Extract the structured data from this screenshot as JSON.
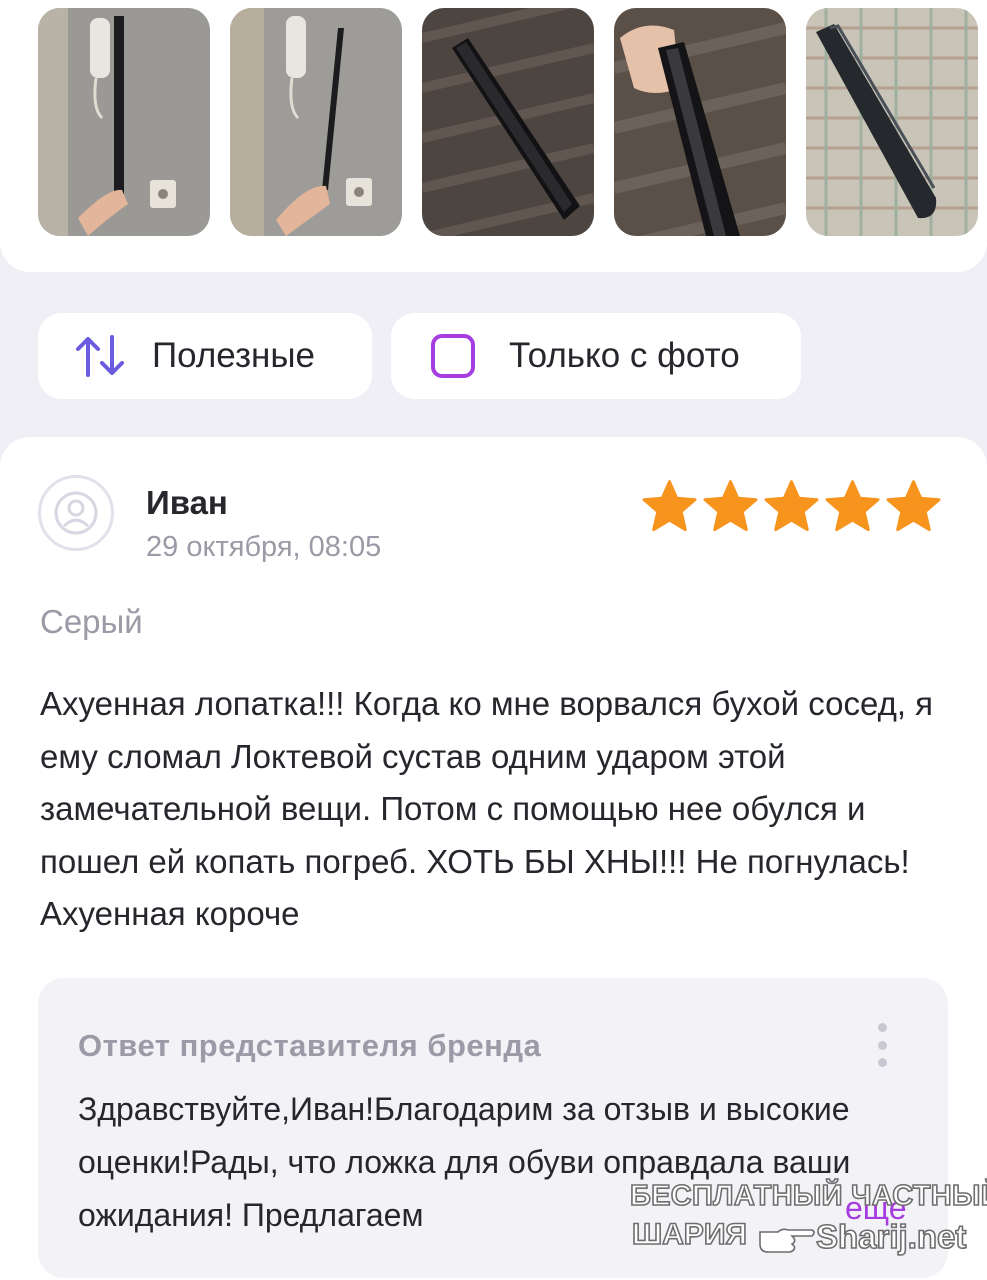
{
  "photos": [
    {
      "name": "photo-1"
    },
    {
      "name": "photo-2"
    },
    {
      "name": "photo-3"
    },
    {
      "name": "photo-4"
    },
    {
      "name": "photo-5"
    }
  ],
  "filters": {
    "sort_label": "Полезные",
    "sort_icon": "sort-arrows-icon",
    "photo_only_label": "Только с фото",
    "photo_only_checked": false
  },
  "review": {
    "author": "Иван",
    "date": "29 октября, 08:05",
    "rating": 5,
    "rating_max": 5,
    "variant": "Серый",
    "text": "Ахуенная лопатка!!! Когда ко мне ворвался бухой сосед, я ему сломал Локтевой сустав одним ударом этой замечательной вещи. Потом с помощью нее обулся и пошел ей копать погреб. ХОТЬ БЫ ХНЫ!!! Не погнулась! Ахуенная короче"
  },
  "reply": {
    "title": "Ответ представителя бренда",
    "text": "Здравствуйте,Иван!Благодарим за отзыв и высокие оценки!Рады, что ложка для обуви оправдала ваши ожидания! Предлагаем",
    "more_label": "еще"
  },
  "watermark": {
    "line1": "БЕСПЛАТНЫЙ ЧАСТНЫЙ",
    "line2": "ШАРИЯ",
    "line3": "Sharij.net"
  },
  "colors": {
    "accent": "#a53de0",
    "star": "#f7941d",
    "sort_icon": "#6a5be0",
    "muted_text": "#9c9aa6",
    "background": "#f0eff6"
  }
}
